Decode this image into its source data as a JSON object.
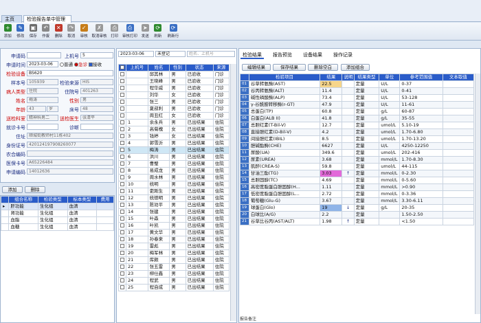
{
  "app": {
    "tab_home": "主页",
    "tab_doc": "检验报告单中管理"
  },
  "toolbar": [
    {
      "icon": "add-icon",
      "label": "添加",
      "color": "#2f8a2f"
    },
    {
      "icon": "edit-icon",
      "label": "修改",
      "color": "#3a6fc4"
    },
    {
      "icon": "save-icon",
      "label": "保存",
      "color": "#6b6b6b"
    },
    {
      "icon": "undo-icon",
      "label": "作废",
      "color": "#888"
    },
    {
      "icon": "delete-icon",
      "label": "删除",
      "color": "#c0392b"
    },
    {
      "icon": "redo-icon",
      "label": "取消",
      "color": "#999"
    },
    {
      "icon": "audit-icon",
      "label": "审核",
      "color": "#c77d19"
    },
    {
      "icon": "unaudit-icon",
      "label": "取消审核",
      "color": "#999"
    },
    {
      "icon": "print-icon",
      "label": "打印",
      "color": "#999"
    },
    {
      "icon": "audit-print-icon",
      "label": "审核打印",
      "color": "#3a6fc4"
    },
    {
      "icon": "send-icon",
      "label": "发送",
      "color": "#999"
    },
    {
      "icon": "refresh-icon",
      "label": "刷新",
      "color": "#2f8a2f"
    },
    {
      "icon": "refresh-row-icon",
      "label": "刷新行",
      "color": "#3a6fc4"
    }
  ],
  "form": {
    "apply_no_label": "申请码",
    "apply_no": "",
    "seq_label": "上机号",
    "seq": "5",
    "apply_time_label": "申请时间",
    "apply_time": "2023-03-06",
    "normal": "普通",
    "urgent": "急诊",
    "receive": "接收",
    "device_label": "检验设备",
    "device": "BS620",
    "sample_no_label": "样本号",
    "sample_no": "105939",
    "source_label": "检验来源",
    "source": "HIS",
    "patient_type_label": "病人类型",
    "patient_type": "住院",
    "hosp_no_label": "住院号",
    "hosp_no": "401263",
    "name_label": "姓名",
    "name": "梅涛",
    "gender_label": "性别",
    "gender": "男",
    "age_label": "年龄",
    "age": "43",
    "age_unit": "岁",
    "bed_label": "床号",
    "bed": "48",
    "dept_label": "送检科室",
    "dept": "精神科男二",
    "doctor_label": "送检医生",
    "doctor": "张清平",
    "ward_label": "就诊卡号",
    "ward": "",
    "diag_label": "诊断",
    "diag": "",
    "address_label": "住址",
    "address": "顺城街教师村11栋402",
    "id_label": "身份证号",
    "id": "420124197908260077",
    "rural_label": "农合编码",
    "rural": "",
    "insure_label": "医保卡号",
    "insure": "A65226484",
    "apply_code_label": "申请编码",
    "apply_code": "14012636"
  },
  "left_buttons": {
    "add": "添加",
    "del": "删除"
  },
  "group_table": {
    "headers": [
      "组合名称",
      "检验类型",
      "标本类型",
      "费用"
    ],
    "rows": [
      [
        "肝功能",
        "生化组",
        "血清",
        ""
      ],
      [
        "肾功能",
        "生化组",
        "血清",
        ""
      ],
      [
        "血脂",
        "生化组",
        "血清",
        ""
      ],
      [
        "血糖",
        "生化组",
        "血清",
        ""
      ]
    ]
  },
  "list_filter": {
    "date": "2023-03-06",
    "status": "未登记",
    "search_placeholder": "姓名、上机号"
  },
  "patient_table": {
    "headers": [
      "上机号",
      "姓名",
      "性别",
      "状态",
      "来源"
    ],
    "rows": [
      [
        "",
        "邱其林",
        "男",
        "已验收",
        "门诊"
      ],
      [
        "",
        "王晓峰",
        "男",
        "已验收",
        "门诊"
      ],
      [
        "",
        "程华威",
        "男",
        "已验收",
        "门诊"
      ],
      [
        "",
        "刘华",
        "女",
        "已验收",
        "门诊"
      ],
      [
        "",
        "张三",
        "男",
        "已验收",
        "门诊"
      ],
      [
        "",
        "夏叔利",
        "男",
        "已验收",
        "门诊"
      ],
      [
        "",
        "周丑红",
        "女",
        "已验收",
        "门诊"
      ],
      [
        "1",
        "余永兵",
        "男",
        "已出结果",
        "住院"
      ],
      [
        "2",
        "高菊槐",
        "女",
        "已出结果",
        "住院"
      ],
      [
        "3",
        "钱婷",
        "女",
        "已出结果",
        "住院"
      ],
      [
        "4",
        "郭雪沂",
        "男",
        "已出结果",
        "住院"
      ],
      [
        "5",
        "梅涛",
        "男",
        "已出结果",
        "住院"
      ],
      [
        "6",
        "洪川",
        "男",
        "已出结果",
        "住院"
      ],
      [
        "7",
        "曹璧",
        "男",
        "已出结果",
        "住院"
      ],
      [
        "8",
        "易成龙",
        "男",
        "已出结果",
        "住院"
      ],
      [
        "9",
        "周水林",
        "男",
        "已出结果",
        "住院"
      ],
      [
        "10",
        "统明",
        "男",
        "已出结果",
        "住院"
      ],
      [
        "11",
        "吏刚生",
        "男",
        "已出结果",
        "住院"
      ],
      [
        "12",
        "统德明",
        "男",
        "已出结果",
        "住院"
      ],
      [
        "13",
        "陈劝平",
        "男",
        "已出结果",
        "住院"
      ],
      [
        "14",
        "张建",
        "男",
        "已出结果",
        "住院"
      ],
      [
        "15",
        "叶森",
        "男",
        "已出结果",
        "住院"
      ],
      [
        "16",
        "叶凯",
        "男",
        "已出结果",
        "住院"
      ],
      [
        "17",
        "黄文华",
        "男",
        "已出结果",
        "住院"
      ],
      [
        "18",
        "孙春来",
        "男",
        "已出结果",
        "住院"
      ],
      [
        "19",
        "雷彪",
        "男",
        "已出结果",
        "住院"
      ],
      [
        "20",
        "梅军林",
        "男",
        "已出结果",
        "住院"
      ],
      [
        "21",
        "库颇",
        "男",
        "已出结果",
        "住院"
      ],
      [
        "22",
        "张五雷",
        "男",
        "已出结果",
        "住院"
      ],
      [
        "23",
        "柳仕鑫",
        "男",
        "已出结果",
        "住院"
      ],
      [
        "24",
        "程武",
        "男",
        "已出结果",
        "住院"
      ],
      [
        "25",
        "程自成",
        "男",
        "已出结果",
        "住院"
      ]
    ]
  },
  "right_tabs": [
    "检验结果",
    "报告预览",
    "设备结果",
    "操作记录"
  ],
  "right_buttons": [
    "编辑结果",
    "保存结果",
    "删除空白",
    "添加组合"
  ],
  "result_table": {
    "headers": [
      "检验项目",
      "结果",
      "说明",
      "结果类型",
      "单位",
      "参考范围值",
      "文本取值"
    ],
    "rows": [
      [
        "01",
        "谷草转氨酶(AST)",
        "22.5",
        "",
        "定量",
        "U/L",
        "0-37",
        "",
        "y"
      ],
      [
        "02",
        "谷丙转氨酶(ALT)",
        "11.4",
        "",
        "定量",
        "U/L",
        "0-41",
        "",
        ""
      ],
      [
        "03",
        "碱性磷酸酶(ALP)",
        "73.4",
        "",
        "定量",
        "U/L",
        "53-128",
        "",
        ""
      ],
      [
        "04",
        "γ-谷酰胺转移酶(r-GT)",
        "47.9",
        "",
        "定量",
        "U/L",
        "11-61",
        "",
        ""
      ],
      [
        "05",
        "总蛋白(TP)",
        "60.8",
        "",
        "定量",
        "g/L",
        "60-87",
        "",
        ""
      ],
      [
        "06",
        "白蛋白(ALB II)",
        "41.8",
        "",
        "定量",
        "g/L",
        "35-55",
        "",
        ""
      ],
      [
        "07",
        "总胆红素(T-Bil-V)",
        "12.7",
        "",
        "定量",
        "umol/L",
        "5.10-19",
        "",
        ""
      ],
      [
        "08",
        "直接胆红素(D-Bil-V)",
        "4.2",
        "",
        "定量",
        "umol/L",
        "1.70-6.80",
        "",
        ""
      ],
      [
        "09",
        "间接胆红素(IBIL)",
        "8.5",
        "",
        "定量",
        "umol/L",
        "1.70-13.20",
        "",
        ""
      ],
      [
        "10",
        "胆碱酯酶(CHE)",
        "6627",
        "",
        "定量",
        "U/L",
        "4250-12250",
        "",
        ""
      ],
      [
        "11",
        "尿酸(UA)",
        "349.6",
        "",
        "定量",
        "umol/L",
        "202-416",
        "",
        ""
      ],
      [
        "12",
        "尿素(UREA)",
        "3.68",
        "",
        "定量",
        "mmol/L",
        "1.70-8.30",
        "",
        ""
      ],
      [
        "13",
        "肌酐(CREA-S)",
        "59.8",
        "",
        "定量",
        "umol/L",
        "44-115",
        "",
        ""
      ],
      [
        "14",
        "甘油三酯(TG)",
        "3.03",
        "↑",
        "定量",
        "mmol/L",
        "0-2.30",
        "",
        "p"
      ],
      [
        "15",
        "总胆固醇(TC)",
        "4.69",
        "",
        "定量",
        "mmol/L",
        "0-5.60",
        "",
        ""
      ],
      [
        "16",
        "高密度脂蛋白胆固醇(H...",
        "1.11",
        "",
        "定量",
        "mmol/L",
        ">0.90",
        "",
        ""
      ],
      [
        "17",
        "低密度脂蛋白胆固醇(L...",
        "2.72",
        "",
        "定量",
        "mmol/L",
        "0-3.36",
        "",
        ""
      ],
      [
        "18",
        "葡萄糖(Glu-G)",
        "3.67",
        "",
        "定量",
        "mmol/L",
        "3.30-6.11",
        "",
        ""
      ],
      [
        "19",
        "球蛋白(Glo)",
        "19",
        "↓",
        "定量",
        "g/L",
        "20-35",
        "",
        "b"
      ],
      [
        "20",
        "白球比(A/G)",
        "2.2",
        "",
        "定量",
        "",
        "1.50-2.50",
        "",
        ""
      ],
      [
        "21",
        "谷草比谷丙(AST/ALT)",
        "1.98",
        "↑",
        "定量",
        "",
        "<1.50",
        "",
        ""
      ]
    ]
  },
  "status_bar": {
    "note": "报告备注"
  }
}
